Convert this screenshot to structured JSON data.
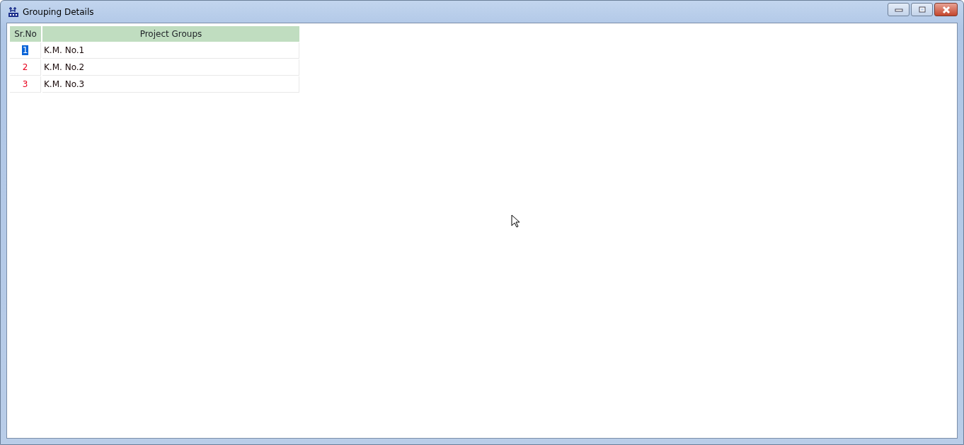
{
  "window": {
    "title": "Grouping Details"
  },
  "table": {
    "columns": [
      "Sr.No",
      "Project Groups"
    ],
    "rows": [
      {
        "sr_no": "1",
        "group": "K.M. No.1",
        "selected": true
      },
      {
        "sr_no": "2",
        "group": "K.M. No.2",
        "selected": false
      },
      {
        "sr_no": "3",
        "group": "K.M. No.3",
        "selected": false
      }
    ]
  }
}
